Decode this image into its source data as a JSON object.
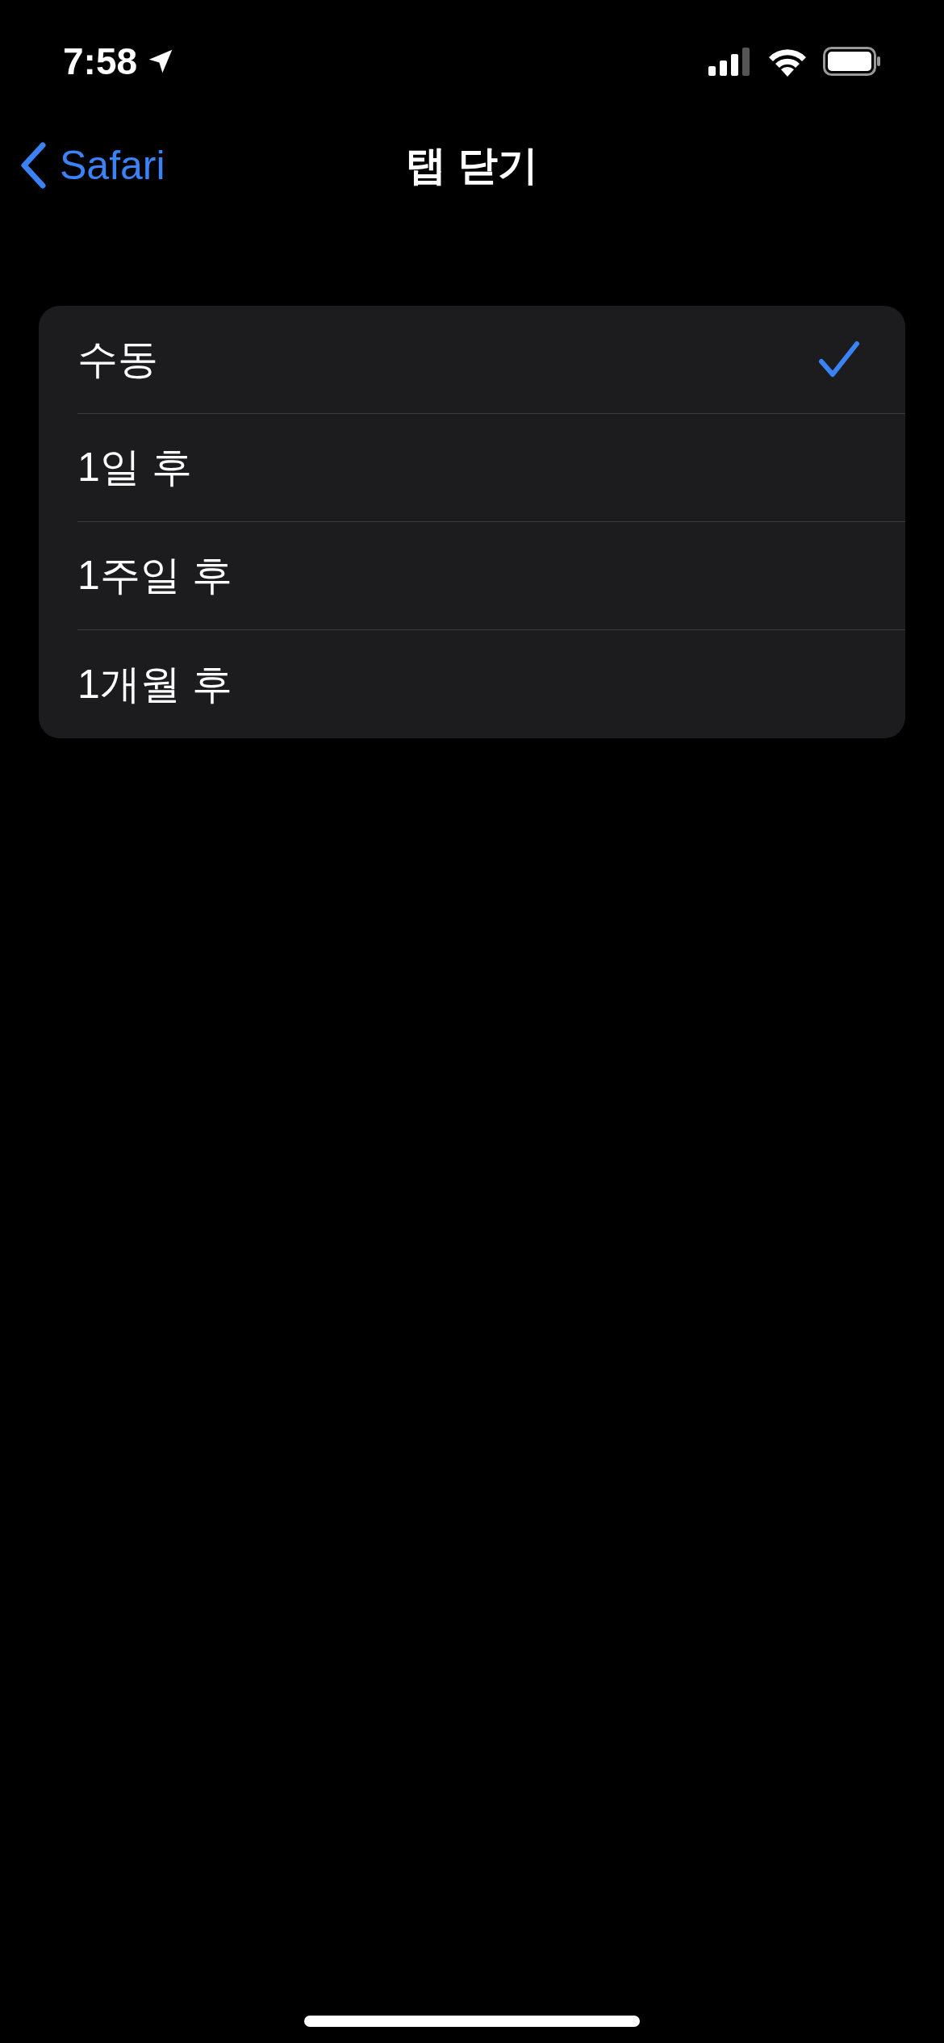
{
  "status_bar": {
    "time": "7:58"
  },
  "nav": {
    "back": "Safari",
    "title": "탭 닫기"
  },
  "options": [
    {
      "label": "수동",
      "selected": true
    },
    {
      "label": "1일 후",
      "selected": false
    },
    {
      "label": "1주일 후",
      "selected": false
    },
    {
      "label": "1개월 후",
      "selected": false
    }
  ]
}
